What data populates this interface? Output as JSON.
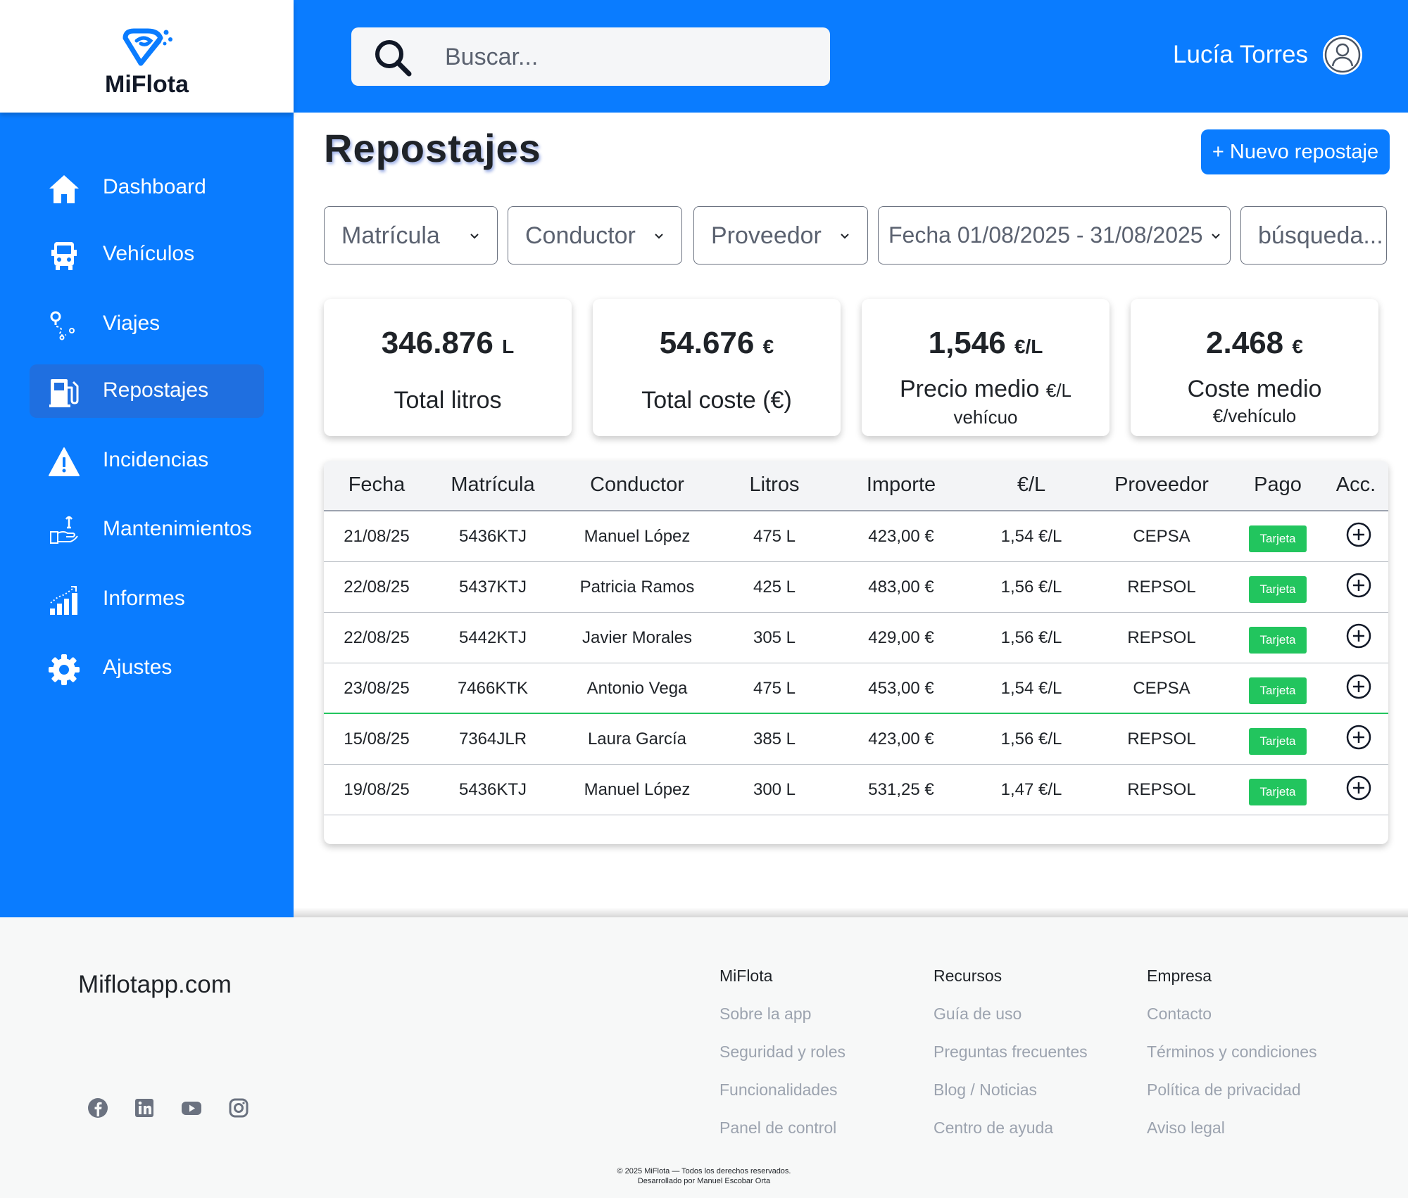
{
  "app": {
    "name": "MiFlota"
  },
  "header": {
    "search_placeholder": "Buscar...",
    "user_name": "Lucía Torres"
  },
  "sidebar": {
    "items": [
      {
        "label": "Dashboard",
        "icon": "home-icon"
      },
      {
        "label": "Vehículos",
        "icon": "truck-icon"
      },
      {
        "label": "Viajes",
        "icon": "route-icon"
      },
      {
        "label": "Repostajes",
        "icon": "fuel-pump-icon",
        "active": true
      },
      {
        "label": "Incidencias",
        "icon": "warning-icon"
      },
      {
        "label": "Mantenimientos",
        "icon": "maintenance-icon"
      },
      {
        "label": "Informes",
        "icon": "bar-chart-icon"
      },
      {
        "label": "Ajustes",
        "icon": "gear-icon"
      }
    ]
  },
  "page": {
    "title": "Repostajes",
    "new_button": "+ Nuevo repostaje"
  },
  "filters": [
    {
      "label": "Matrícula"
    },
    {
      "label": "Conductor"
    },
    {
      "label": "Proveedor"
    },
    {
      "label": "Fecha 01/08/2025 - 31/08/2025"
    },
    {
      "label": "búsqueda..."
    }
  ],
  "summary": [
    {
      "value": "346.876",
      "unit": "L",
      "label": "Total litros"
    },
    {
      "value": "54.676",
      "unit": "€",
      "label": "Total coste (€)"
    },
    {
      "value": "1,546",
      "unit": "€/L",
      "label": "Precio medio",
      "label_unit": "€/L",
      "sublabel": "vehícuo"
    },
    {
      "value": "2.468",
      "unit": "€",
      "label": "Coste medio",
      "sublabel": "€/vehículo"
    }
  ],
  "table": {
    "columns": [
      "Fecha",
      "Matrícula",
      "Conductor",
      "Litros",
      "Importe",
      "€/L",
      "Proveedor",
      "Pago",
      "Acc."
    ],
    "rows": [
      {
        "fecha": "21/08/25",
        "matricula": "5436KTJ",
        "conductor": "Manuel López",
        "litros": "475 L",
        "importe": "423,00 €",
        "precio": "1,54 €/L",
        "proveedor": "CEPSA",
        "pago": "Tarjeta"
      },
      {
        "fecha": "22/08/25",
        "matricula": "5437KTJ",
        "conductor": "Patricia Ramos",
        "litros": "425 L",
        "importe": "483,00 €",
        "precio": "1,56 €/L",
        "proveedor": "REPSOL",
        "pago": "Tarjeta"
      },
      {
        "fecha": "22/08/25",
        "matricula": "5442KTJ",
        "conductor": "Javier Morales",
        "litros": "305 L",
        "importe": "429,00 €",
        "precio": "1,56 €/L",
        "proveedor": "REPSOL",
        "pago": "Tarjeta"
      },
      {
        "fecha": "23/08/25",
        "matricula": "7466KTK",
        "conductor": "Antonio Vega",
        "litros": "475 L",
        "importe": "453,00 €",
        "precio": "1,54 €/L",
        "proveedor": "CEPSA",
        "pago": "Tarjeta"
      },
      {
        "fecha": "15/08/25",
        "matricula": "7364JLR",
        "conductor": "Laura García",
        "litros": "385 L",
        "importe": "423,00 €",
        "precio": "1,56 €/L",
        "proveedor": "REPSOL",
        "pago": "Tarjeta"
      },
      {
        "fecha": "19/08/25",
        "matricula": "5436KTJ",
        "conductor": "Manuel López",
        "litros": "300 L",
        "importe": "531,25 €",
        "precio": "1,47 €/L",
        "proveedor": "REPSOL",
        "pago": "Tarjeta"
      }
    ]
  },
  "footer": {
    "brand": "Miflotapp.com",
    "social": [
      "facebook-icon",
      "linkedin-icon",
      "youtube-icon",
      "instagram-icon"
    ],
    "columns": [
      {
        "title": "MiFlota",
        "links": [
          "Sobre la app",
          "Seguridad y roles",
          "Funcionalidades",
          "Panel de control"
        ]
      },
      {
        "title": "Recursos",
        "links": [
          "Guía de uso",
          "Preguntas frecuentes",
          "Blog / Noticias",
          "Centro de ayuda"
        ]
      },
      {
        "title": "Empresa",
        "links": [
          "Contacto",
          "Términos y condiciones",
          "Política de privacidad",
          "Aviso legal"
        ]
      }
    ],
    "copyright_line1": "© 2025 MiFlota — Todos los derechos reservados.",
    "copyright_line2": "Desarrollado por Manuel Escobar Orta"
  },
  "colors": {
    "primary": "#0a7cff",
    "active_nav": "#1f6fe0",
    "badge_green": "#22c55e",
    "footer_bg": "#f7f8f8"
  }
}
